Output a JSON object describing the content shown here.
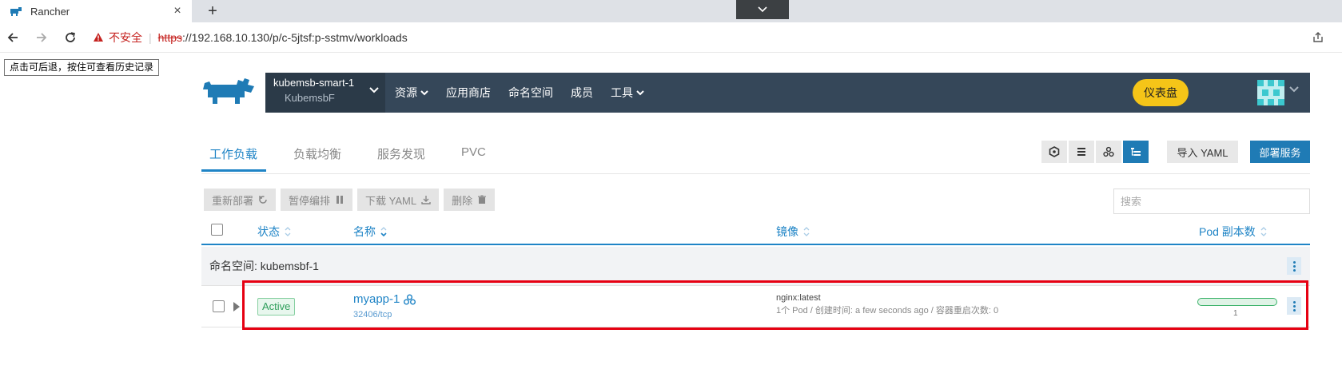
{
  "browser": {
    "tab_title": "Rancher",
    "new_tab": "+",
    "close": "×",
    "security_warning": "不安全",
    "url_scheme": "https",
    "url_rest": "://192.168.10.130/p/c-5jtsf:p-sstmv/workloads",
    "back_tooltip": "点击可后退，按住可查看历史记录"
  },
  "header": {
    "cluster_name": "kubemsb-smart-1",
    "project_name": "KubemsbF",
    "menu": [
      {
        "label": "资源",
        "dropdown": true
      },
      {
        "label": "应用商店",
        "dropdown": false
      },
      {
        "label": "命名空间",
        "dropdown": false
      },
      {
        "label": "成员",
        "dropdown": false
      },
      {
        "label": "工具",
        "dropdown": true
      }
    ],
    "dashboard_button": "仪表盘"
  },
  "subtabs": [
    {
      "label": "工作负载",
      "active": true
    },
    {
      "label": "负载均衡",
      "active": false
    },
    {
      "label": "服务发现",
      "active": false
    },
    {
      "label": "PVC",
      "active": false
    }
  ],
  "toolbar": {
    "import_yaml": "导入 YAML",
    "deploy_service": "部署服务",
    "actions": {
      "redeploy": "重新部署",
      "pause": "暂停编排",
      "download": "下载 YAML",
      "delete": "删除"
    },
    "search_placeholder": "搜索"
  },
  "table": {
    "columns": {
      "status": "状态",
      "name": "名称",
      "image": "镜像",
      "pods": "Pod 副本数"
    },
    "group_label": "命名空间: kubemsbf-1",
    "rows": [
      {
        "status": "Active",
        "name": "myapp-1",
        "port": "32406/tcp",
        "image": "nginx:latest",
        "meta": "1个 Pod / 创建时间: a few seconds ago / 容器重启次数: 0",
        "pod_count": "1",
        "pods_ready_fraction": 1.0
      }
    ]
  },
  "colors": {
    "accent": "#1f84c6",
    "nav_bg": "#354759",
    "dashboard": "#f5c518",
    "highlight": "#e60012",
    "active_status": "#2e9e5b"
  }
}
